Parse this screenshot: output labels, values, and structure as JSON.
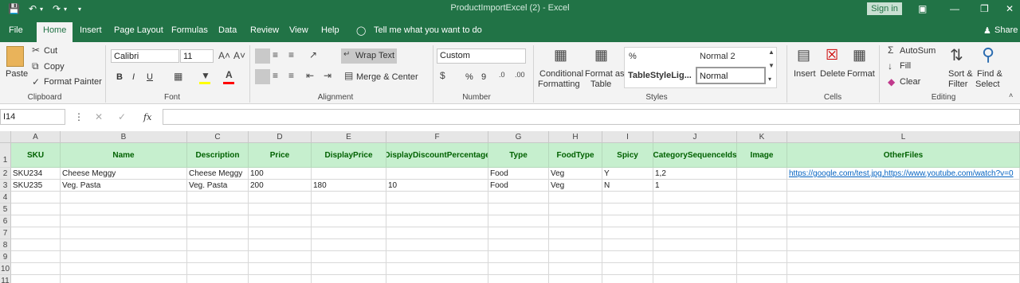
{
  "titlebar": {
    "title": "ProductImportExcel (2)  -  Excel",
    "sign_in": "Sign in",
    "save_icon": "save-icon",
    "undo_icon": "undo-icon",
    "redo_icon": "redo-icon"
  },
  "tabs": {
    "file": "File",
    "home": "Home",
    "insert": "Insert",
    "page_layout": "Page Layout",
    "formulas": "Formulas",
    "data": "Data",
    "review": "Review",
    "view": "View",
    "help": "Help",
    "tell_me": "Tell me what you want to do",
    "share": "Share"
  },
  "ribbon": {
    "clipboard": {
      "paste": "Paste",
      "cut": "Cut",
      "copy": "Copy",
      "format_painter": "Format Painter",
      "label": "Clipboard"
    },
    "font": {
      "name": "Calibri",
      "size": "11",
      "label": "Font",
      "bold": "B",
      "italic": "I",
      "underline": "U"
    },
    "alignment": {
      "wrap_text": "Wrap Text",
      "merge_center": "Merge & Center",
      "label": "Alignment"
    },
    "number": {
      "format": "Custom",
      "percent": "%",
      "comma": "9",
      "label": "Number"
    },
    "styles": {
      "conditional_line1": "Conditional",
      "conditional_line2": "Formatting",
      "format_as_line1": "Format as",
      "format_as_line2": "Table",
      "style_percent": "%",
      "style_normal2": "Normal 2",
      "style_table": "TableStyleLig...",
      "style_normal": "Normal",
      "label": "Styles"
    },
    "cells": {
      "insert": "Insert",
      "delete": "Delete",
      "format": "Format",
      "label": "Cells"
    },
    "editing": {
      "autosum": "AutoSum",
      "fill": "Fill",
      "clear": "Clear",
      "sort_line1": "Sort &",
      "sort_line2": "Filter",
      "find_line1": "Find &",
      "find_line2": "Select",
      "label": "Editing"
    }
  },
  "formula_bar": {
    "name_box": "I14",
    "fx": "fx",
    "formula": ""
  },
  "sheet": {
    "columns": [
      "A",
      "B",
      "C",
      "D",
      "E",
      "F",
      "G",
      "H",
      "I",
      "J",
      "K",
      "L"
    ],
    "rows": [
      "1",
      "2",
      "3",
      "4",
      "5",
      "6",
      "7",
      "8",
      "9",
      "10",
      "11"
    ],
    "headers": [
      "SKU",
      "Name",
      "Description",
      "Price",
      "DisplayPrice",
      "DisplayDiscountPercentage",
      "Type",
      "FoodType",
      "Spicy",
      "CategorySequenceIds",
      "Image",
      "OtherFiles"
    ],
    "data": [
      [
        "SKU234",
        "Cheese Meggy",
        "Cheese Meggy",
        "100",
        "",
        "",
        "Food",
        "Veg",
        "Y",
        "1,2",
        "",
        "https://google.com/test.jpg,https://www.youtube.com/watch?v=0"
      ],
      [
        "SKU235",
        "Veg. Pasta",
        "Veg. Pasta",
        "200",
        "180",
        "10",
        "Food",
        "Veg",
        "N",
        "1",
        "",
        ""
      ]
    ]
  },
  "colors": {
    "accent": "#217346",
    "header_fill": "#c6efce",
    "header_text": "#006100",
    "link": "#0563c1"
  }
}
